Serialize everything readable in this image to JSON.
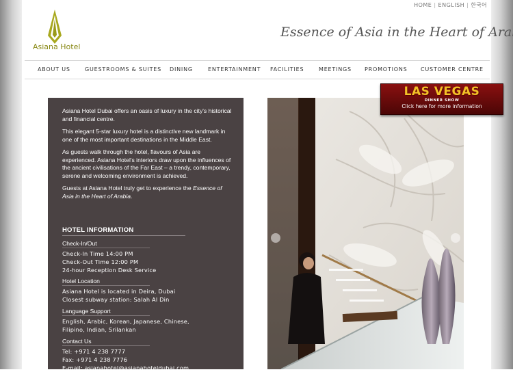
{
  "header": {
    "top_links": [
      "HOME",
      "ENGLISH",
      "한국어"
    ],
    "logo_text": "Asiana Hotel",
    "tagline": "Essence of Asia in the Heart of Arabia"
  },
  "nav": [
    "ABOUT US",
    "GUESTROOMS & SUITES",
    "DINING",
    "ENTERTAINMENT",
    "FACILITIES",
    "MEETINGS",
    "PROMOTIONS",
    "CUSTOMER CENTRE"
  ],
  "intro": {
    "p1": "Asiana Hotel Dubai offers an oasis of luxury in the city's historical and financial centre.",
    "p2": "This elegant 5-star luxury hotel is a distinctive new landmark in one of the most important destinations in the Middle East.",
    "p3": "As guests walk through the hotel, flavours of Asia are experienced. Asiana Hotel's interiors draw upon the influences of the ancient civilisations of the Far East – a trendy, contemporary, serene and welcoming environment is achieved.",
    "p4_prefix": "Guests at Asiana Hotel truly get to experience the ",
    "p4_italic": "Essence of Asia in the Heart of Arabia",
    "p4_suffix": "."
  },
  "hotel_info": {
    "title": "HOTEL INFORMATION",
    "checkin": {
      "heading": "Check-In/Out",
      "lines": [
        "Check-In Time 14:00 PM",
        "Check-Out Time 12:00 PM",
        "24-hour Reception Desk Service"
      ]
    },
    "location": {
      "heading": "Hotel Location",
      "lines": [
        "Asiana Hotel is located in Deira, Dubai",
        "Closest subway station: Salah Al Din"
      ]
    },
    "language": {
      "heading": "Language Support",
      "lines": [
        "English, Arabic, Korean, Japanese, Chinese,",
        "Filipino, Indian, Srilankan"
      ]
    },
    "contact": {
      "heading": "Contact Us",
      "lines": [
        "Tel: +971 4 238 7777",
        "Fax: +971 4 238 7776",
        "E-mail: asianahotel@asianahoteldubai.com"
      ]
    }
  },
  "promo": {
    "title": "LAS VEGAS",
    "subtitle": "DINNER SHOW",
    "cta": "Click here for more information"
  },
  "colors": {
    "panel": "#4a4243",
    "logo_gold": "#8a8a18",
    "promo_red": "#8a1010",
    "promo_gold": "#f3c227"
  }
}
